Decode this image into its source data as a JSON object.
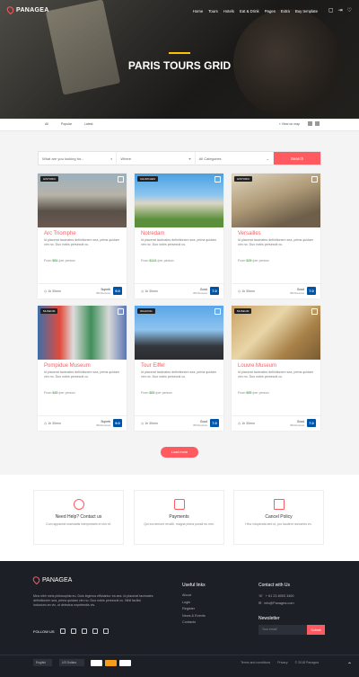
{
  "brand": "PANAGEA",
  "nav": [
    "Home",
    "Tours",
    "Hotels",
    "Eat & Drink",
    "Pages",
    "Extra",
    "Buy template"
  ],
  "hero_title": "PARIS TOURS GRID",
  "filters": {
    "items": [
      "All",
      "Popular",
      "Latest"
    ],
    "view_map": "View on map"
  },
  "search": {
    "placeholder_what": "What are you looking for...",
    "placeholder_where": "Where",
    "category": "All Categories",
    "button": "Search"
  },
  "tours": [
    {
      "tag": "HISTORIC",
      "name": "Arc Triomphe",
      "desc": "Id placerat tacimates definitionem sea, prima quidam vim no. Duo nobis persecuti cu.",
      "price_label": "From",
      "price": "$54",
      "per": "/per person",
      "duration": "1h 30min",
      "rating_label": "Superb",
      "reviews": "350 Reviews",
      "score": "9.0"
    },
    {
      "tag": "CHURCHES",
      "name": "Notredam",
      "desc": "Id placerat tacimates definitionem sea, prima quidam vim no. Duo nobis persecuti cu.",
      "price_label": "From",
      "price": "$124",
      "per": "/per person",
      "duration": "1h 30min",
      "rating_label": "Good",
      "reviews": "350 Reviews",
      "score": "7.0"
    },
    {
      "tag": "HISTORIC",
      "name": "Versailles",
      "desc": "Id placerat tacimates definitionem sea, prima quidam vim no. Duo nobis persecuti cu.",
      "price_label": "From",
      "price": "$25",
      "per": "/per person",
      "duration": "1h 30min",
      "rating_label": "Good",
      "reviews": "350 Reviews",
      "score": "7.0"
    },
    {
      "tag": "MUSEUM",
      "name": "Pompidue Museum",
      "desc": "Id placerat tacimates definitionem sea, prima quidam vim no. Duo nobis persecuti cu.",
      "price_label": "From",
      "price": "$45",
      "per": "/per person",
      "duration": "1h 30min",
      "rating_label": "Superb",
      "reviews": "350 Reviews",
      "score": "9.0"
    },
    {
      "tag": "WALKING",
      "name": "Tour Eiffel",
      "desc": "Id placerat tacimates definitionem sea, prima quidam vim no. Duo nobis persecuti cu.",
      "price_label": "From",
      "price": "$65",
      "per": "/per person",
      "duration": "1h 30min",
      "rating_label": "Good",
      "reviews": "350 Reviews",
      "score": "7.0"
    },
    {
      "tag": "MUSEUM",
      "name": "Louvre Museum",
      "desc": "Id placerat tacimates definitionem sea, prima quidam vim no. Duo nobis persecuti cu.",
      "price_label": "From",
      "price": "$95",
      "per": "/per person",
      "duration": "1h 30min",
      "rating_label": "Good",
      "reviews": "350 Reviews",
      "score": "7.0"
    }
  ],
  "load_more": "Load more",
  "help": [
    {
      "title": "Need Help? Contact us",
      "text": "Cum appareat maestatis interpretaris et vim et."
    },
    {
      "title": "Payments",
      "text": "Qui ea nemore eruditi, magna prima possit eu mei."
    },
    {
      "title": "Cancel Policy",
      "text": "Hinc vituperata sed ut, pro laudem nonumes ex."
    }
  ],
  "footer": {
    "about": "Mea nibh meis philosophia eu. Duis legimus efficiantur ea sea. Id placerat tacimates definitionem sea, prima quidam vim no. Duo nobis persecuti cu. Nihil facilisi indoctum an vix, ut delectus expetendis vis.",
    "follow": "FOLLOW US",
    "links_title": "Useful links",
    "links": [
      "About",
      "Login",
      "Register",
      "News & Events",
      "Contacts"
    ],
    "contact_title": "Contact with Us",
    "phone": "+ 61 23 8093 3400",
    "email": "info@Panagea.com",
    "newsletter": "Newsletter",
    "newsletter_placeholder": "Your email",
    "submit": "Submit",
    "language": "English",
    "currency": "US Dollars",
    "legal": [
      "Terms and conditions",
      "Privacy",
      "© 2018 Panagea"
    ]
  }
}
